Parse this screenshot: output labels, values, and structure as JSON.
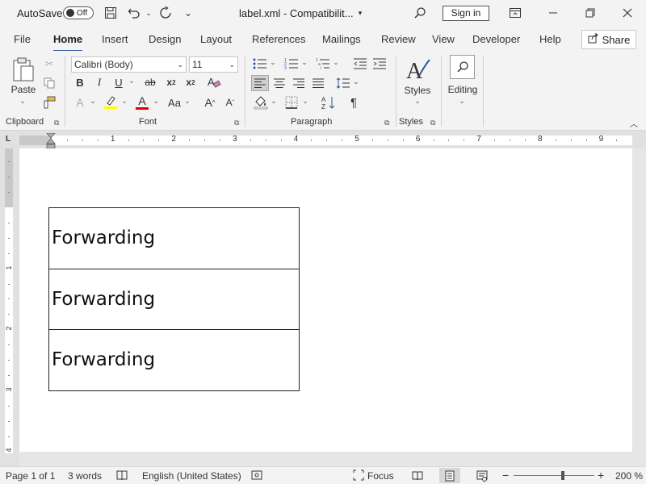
{
  "titlebar": {
    "autosave_label": "AutoSave",
    "autosave_state": "Off",
    "document_title": "label.xml  -  Compatibilit...",
    "signin_label": "Sign in"
  },
  "tabs": [
    {
      "label": "File"
    },
    {
      "label": "Home"
    },
    {
      "label": "Insert"
    },
    {
      "label": "Design"
    },
    {
      "label": "Layout"
    },
    {
      "label": "References"
    },
    {
      "label": "Mailings"
    },
    {
      "label": "Review"
    },
    {
      "label": "View"
    },
    {
      "label": "Developer"
    },
    {
      "label": "Help"
    }
  ],
  "active_tab": "Home",
  "share_label": "Share",
  "ribbon": {
    "paste_label": "Paste",
    "font_name": "Calibri (Body)",
    "font_size": "11",
    "styles_label": "Styles",
    "editing_label": "Editing",
    "groups": {
      "clipboard": "Clipboard",
      "font": "Font",
      "paragraph": "Paragraph",
      "styles": "Styles"
    },
    "font_buttons": {
      "bold": "B",
      "italic": "I",
      "underline": "U",
      "strike": "ab",
      "subscript": "x",
      "subscript_mark": "2",
      "superscript": "x",
      "superscript_mark": "2",
      "change_case": "Aa",
      "grow": "A",
      "shrink": "A",
      "font_color": "A",
      "text_effects": "A"
    },
    "pilcrow": "¶",
    "sort": "A↓Z"
  },
  "ruler": {
    "corner": "L",
    "h_numbers": [
      "1",
      "2",
      "3",
      "4",
      "5",
      "6",
      "7",
      "8",
      "9"
    ],
    "v_numbers": [
      "1",
      "2",
      "3",
      "4"
    ]
  },
  "document": {
    "table_rows": [
      "Forwarding",
      "Forwarding",
      "Forwarding"
    ]
  },
  "statusbar": {
    "page": "Page 1 of 1",
    "words": "3 words",
    "language": "English (United States)",
    "focus": "Focus",
    "zoom_minus": "−",
    "zoom_plus": "+",
    "zoom": "200 %",
    "zoom_level_percent": 200
  },
  "colors": {
    "accent": "#2b579a",
    "highlight": "#ffff00",
    "font_color": "#e00000"
  }
}
